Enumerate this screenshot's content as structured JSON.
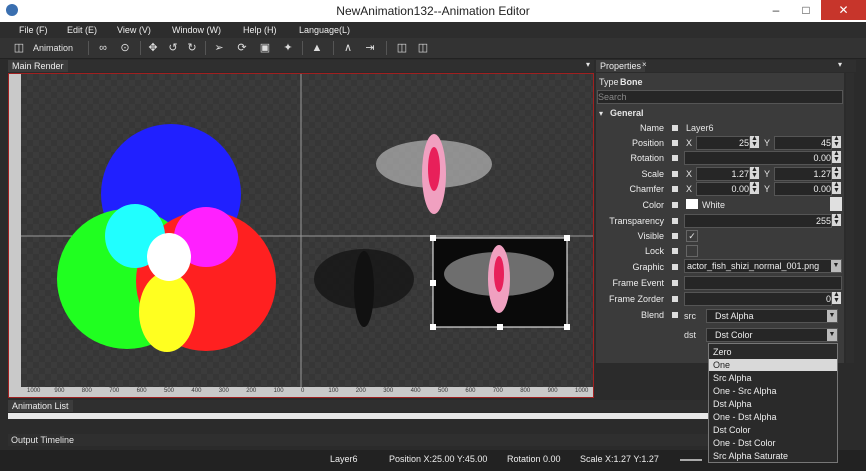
{
  "window": {
    "title": "NewAnimation132--Animation Editor"
  },
  "menu": [
    "File (F)",
    "Edit (E)",
    "View (V)",
    "Window (W)",
    "Help (H)",
    "Language(L)"
  ],
  "toolbar": {
    "animation_label": "Animation"
  },
  "panels": {
    "main_render": "Main Render",
    "properties": "Properties",
    "animation_list": "Animation List",
    "output_timeline": "Output  Timeline"
  },
  "ruler": {
    "labels": [
      "1000",
      "900",
      "800",
      "700",
      "600",
      "500",
      "400",
      "300",
      "200",
      "100",
      "0",
      "100",
      "200",
      "300",
      "400",
      "500",
      "600",
      "700",
      "800",
      "900",
      "1000"
    ]
  },
  "properties": {
    "type_label": "Type",
    "type_value": "Bone",
    "search_placeholder": "Search",
    "section": "General",
    "name_label": "Name",
    "name_value": "Layer6",
    "position_label": "Position",
    "x": "X",
    "y": "Y",
    "position_x": "25",
    "position_y": "45",
    "rotation_label": "Rotation",
    "rotation_value": "0.00",
    "scale_label": "Scale",
    "scale_x": "1.27",
    "scale_y": "1.27",
    "chamfer_label": "Chamfer",
    "chamfer_x": "0.00",
    "chamfer_y": "0.00",
    "color_label": "Color",
    "color_value": "White",
    "transparency_label": "Transparency",
    "transparency_value": "255",
    "visible_label": "Visible",
    "visible_check": "✓",
    "lock_label": "Lock",
    "graphic_label": "Graphic",
    "graphic_value": "actor_fish_shizi_normal_001.png",
    "frame_event_label": "Frame Event",
    "frame_zorder_label": "Frame Zorder",
    "frame_zorder_value": "0",
    "blend_label": "Blend",
    "src_label": "src",
    "src_value": "Dst Alpha",
    "dst_label": "dst",
    "dst_value": "Dst Color"
  },
  "blend_options": [
    "Zero",
    "One",
    "Src Alpha",
    "One - Src Alpha",
    "Dst Alpha",
    "One - Dst Alpha",
    "Dst Color",
    "One - Dst Color",
    "Src Alpha Saturate"
  ],
  "blend_selected": "One",
  "status": {
    "layer": "Layer6",
    "position": "Position X:25.00  Y:45.00",
    "rotation": "Rotation  0.00",
    "scale": "Scale X:1.27  Y:1.27"
  },
  "colors": {
    "accent_red": "#a02020",
    "panel_bg": "#3b3b3b"
  }
}
